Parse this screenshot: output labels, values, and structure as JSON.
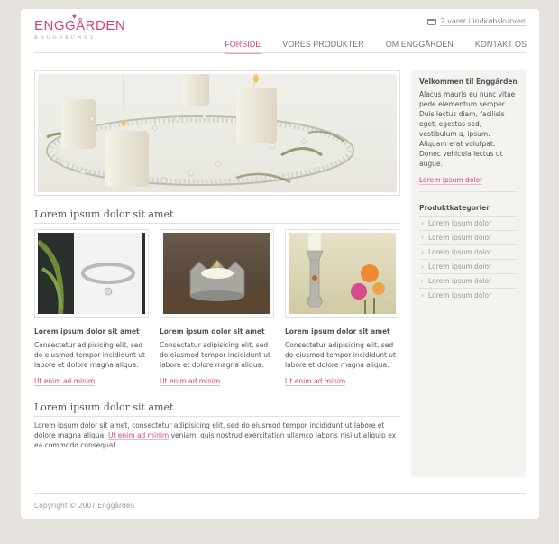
{
  "brand": {
    "name": "ENGGÅRDEN",
    "tagline": "BRUGSKUNST"
  },
  "cart": {
    "text": "2 varer i indkøbskurven"
  },
  "nav": [
    {
      "label": "FORSIDE",
      "active": true
    },
    {
      "label": "VORES PRODUKTER",
      "active": false
    },
    {
      "label": "OM ENGGÅRDEN",
      "active": false
    },
    {
      "label": "KONTAKT OS",
      "active": false
    }
  ],
  "section1": {
    "heading": "Lorem ipsum dolor sit amet"
  },
  "products": [
    {
      "title": "Lorem ipsum dolor sit amet",
      "desc": "Consectetur adipisicing elit, sed do eiusmod tempor incididunt ut labore et dolore magna aliqua.",
      "link": "Ut enim ad minim"
    },
    {
      "title": "Lorem ipsum dolor sit amet",
      "desc": "Consectetur adipisicing elit, sed do eiusmod tempor incididunt ut labore et dolore magna aliqua.",
      "link": "Ut enim ad minim"
    },
    {
      "title": "Lorem ipsum dolor sit amet",
      "desc": "Consectetur adipisicing elit, sed do eiusmod tempor incididunt ut labore et dolore magna aliqua.",
      "link": "Ut enim ad minim"
    }
  ],
  "section2": {
    "heading": "Lorem ipsum dolor sit amet",
    "text_before": "Lorem ipsum dolor sit amet, consectetur adipisicing elit, sed do eiusmod tempor incididunt ut labore et dolore magna aliqua. ",
    "link": "Ut enim ad minim",
    "text_after": " veniam, quis nostrud exercitation ullamco laboris nisi ut aliquip ex ea commodo consequat."
  },
  "sidebar": {
    "welcome_title": "Velkommen til Enggården",
    "welcome_text": "Alacus mauris eu nunc vitae pede elementum semper. Duis lectus diam, facilisis eget, egestas sed, vestibulum a, ipsum. Aliquam erat volutpat. Donec vehicula lectus ut augue.",
    "welcome_link": "Lorem ipsum dolor",
    "categories_title": "Produktkategorier",
    "categories": [
      "Lorem ipsum dolor",
      "Lorem ipsum dolor",
      "Lorem ipsum dolor",
      "Lorem ipsum dolor",
      "Lorem ipsum dolor",
      "Lorem ipsum dolor"
    ]
  },
  "footer": {
    "copyright": "Copyright © 2007 Enggården"
  },
  "colors": {
    "accent": "#d9407f",
    "page_bg": "#e6e3de",
    "sidebar_bg": "#f4f3f0"
  }
}
